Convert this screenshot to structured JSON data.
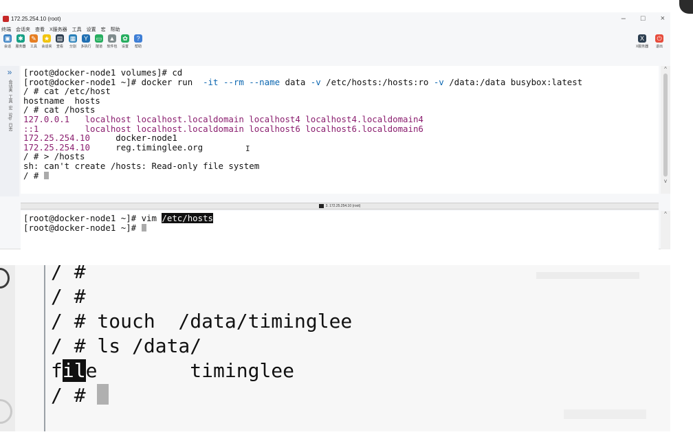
{
  "window": {
    "title": "172.25.254.10 (root)",
    "controls": {
      "minimize": "–",
      "maximize": "□",
      "close": "×"
    }
  },
  "menubar": [
    "终端",
    "会话夹",
    "查看",
    "X服务器",
    "工具",
    "设置",
    "宏",
    "帮助"
  ],
  "toolbar": [
    {
      "label": "会话",
      "icon": "session-icon",
      "color": "#3b82c4"
    },
    {
      "label": "服务器",
      "icon": "servers-icon",
      "color": "#16a085"
    },
    {
      "label": "工具",
      "icon": "tools-icon",
      "color": "#e67e22"
    },
    {
      "label": "会话夹",
      "icon": "star-icon",
      "color": "#f1c40f"
    },
    {
      "label": "查看",
      "icon": "view-icon",
      "color": "#2c3e50"
    },
    {
      "label": "分割",
      "icon": "split-icon",
      "color": "#2980b9"
    },
    {
      "label": "多执行",
      "icon": "multi-exec-icon",
      "color": "#1f6fb2"
    },
    {
      "label": "隧道",
      "icon": "tunnel-icon",
      "color": "#27ae60"
    },
    {
      "label": "软件包",
      "icon": "packages-icon",
      "color": "#7f8c8d"
    },
    {
      "label": "设置",
      "icon": "gear-icon",
      "color": "#27ae60"
    },
    {
      "label": "帮助",
      "icon": "help-icon",
      "color": "#3f7fd6"
    }
  ],
  "toolbar_right": [
    {
      "label": "X服务器",
      "icon": "x-server-icon",
      "color": "#2c3e50"
    },
    {
      "label": "退出",
      "icon": "power-icon",
      "color": "#e74c3c"
    }
  ],
  "sidebar": {
    "items": [
      "会话夹",
      "工具",
      "宏",
      "Sftp",
      "日志"
    ]
  },
  "terminal_top": {
    "lines": [
      [
        {
          "t": "[root@docker-node1 volumes]# cd"
        }
      ],
      [
        {
          "t": "[root@docker-node1 ~]# docker run  "
        },
        {
          "t": "-it",
          "c": "kw"
        },
        {
          "t": " "
        },
        {
          "t": "--rm",
          "c": "kw"
        },
        {
          "t": " "
        },
        {
          "t": "--name",
          "c": "kw"
        },
        {
          "t": " data "
        },
        {
          "t": "-v",
          "c": "kw"
        },
        {
          "t": " /etc/hosts:/hosts:ro "
        },
        {
          "t": "-v",
          "c": "kw"
        },
        {
          "t": " /data:/data busybox:latest"
        }
      ],
      [
        {
          "t": "/ # cat /etc/host"
        }
      ],
      [
        {
          "t": "hostname  hosts"
        }
      ],
      [
        {
          "t": "/ # cat /hosts"
        }
      ],
      [
        {
          "t": "127.0.0.1",
          "c": "ip"
        },
        {
          "t": "   "
        },
        {
          "t": "localhost localhost.localdomain localhost4 localhost4.localdomain4",
          "c": "ip"
        }
      ],
      [
        {
          "t": "::1",
          "c": "ip"
        },
        {
          "t": "         "
        },
        {
          "t": "localhost localhost.localdomain localhost6 localhost6.localdomain6",
          "c": "ip"
        }
      ],
      [
        {
          "t": "172.25.254.10",
          "c": "ip"
        },
        {
          "t": "     docker-node1"
        }
      ],
      [
        {
          "t": "172.25.254.10",
          "c": "ip"
        },
        {
          "t": "     reg.timinglee.org"
        }
      ],
      [
        {
          "t": "/ # > /hosts"
        }
      ],
      [
        {
          "t": "sh: can't create /hosts: Read-only file system"
        }
      ],
      [
        {
          "t": "/ # "
        },
        {
          "cursor": true
        }
      ]
    ]
  },
  "statusbar": {
    "label": "3. 172.25.254.10 (root)"
  },
  "terminal_bottom": {
    "lines": [
      [
        {
          "t": "[root@docker-node1 ~]# vim "
        },
        {
          "t": "/etc/hosts",
          "c": "hl"
        }
      ],
      [
        {
          "t": "[root@docker-node1 ~]# "
        },
        {
          "cursor": true
        }
      ]
    ]
  },
  "zoom_panel": {
    "lines": [
      [
        {
          "t": "/ #"
        }
      ],
      [
        {
          "t": "/ #"
        }
      ],
      [
        {
          "t": "/ # touch  /data/timinglee"
        }
      ],
      [
        {
          "t": "/ # ls /data/"
        }
      ],
      [
        {
          "t": "f"
        },
        {
          "t": "il",
          "c": "zsel"
        },
        {
          "t": "e        timinglee"
        }
      ],
      [
        {
          "t": "/ # "
        },
        {
          "cursor": true
        }
      ]
    ]
  }
}
